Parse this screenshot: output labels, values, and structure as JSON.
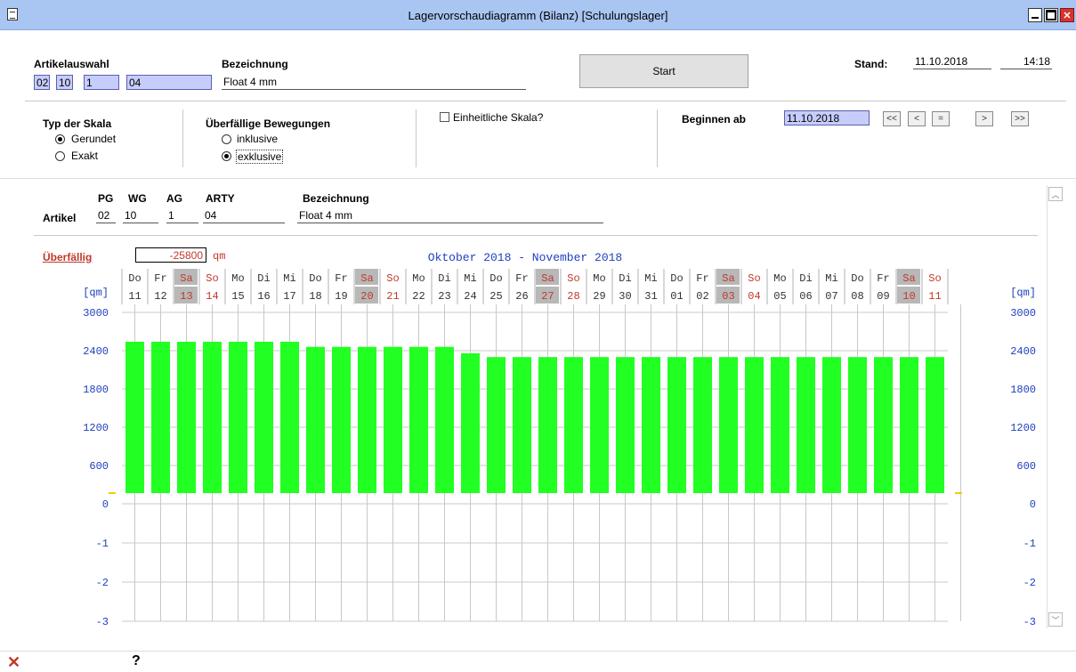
{
  "window": {
    "title": "Lagervorschaudiagramm (Bilanz) [Schulungslager]"
  },
  "artikelauswahl": {
    "label": "Artikelauswahl",
    "pg": "02",
    "wg": "10",
    "ag": "1",
    "arty": "04"
  },
  "bezeichnung": {
    "label": "Bezeichnung",
    "value": "Float 4 mm"
  },
  "start_button": "Start",
  "stand": {
    "label": "Stand:",
    "date": "11.10.2018",
    "time": "14:18"
  },
  "skala": {
    "label": "Typ der Skala",
    "options": [
      "Gerundet",
      "Exakt"
    ],
    "selected": "Gerundet"
  },
  "bewegungen": {
    "label": "Überfällige Bewegungen",
    "options": [
      "inklusive",
      "exklusive"
    ],
    "selected": "exklusive"
  },
  "einheitlich": {
    "label": "Einheitliche Skala?",
    "checked": false
  },
  "beginnen": {
    "label": "Beginnen ab",
    "date": "11.10.2018",
    "nav": [
      "<<",
      "<",
      "=",
      ">",
      ">>"
    ]
  },
  "artikel_row": {
    "label": "Artikel",
    "headers": {
      "pg": "PG",
      "wg": "WG",
      "ag": "AG",
      "arty": "ARTY",
      "bez": "Bezeichnung"
    },
    "pg": "02",
    "wg": "10",
    "ag": "1",
    "arty": "04",
    "bez": "Float 4 mm"
  },
  "ueberfaellig": {
    "label": "Überfällig",
    "value": "-25800",
    "unit": "qm"
  },
  "chart_data": {
    "type": "bar",
    "title": "Oktober 2018   -   November 2018",
    "unit_left": "[qm]",
    "unit_right": "[qm]",
    "weekdays": [
      "Do",
      "Fr",
      "Sa",
      "So",
      "Mo",
      "Di",
      "Mi",
      "Do",
      "Fr",
      "Sa",
      "So",
      "Mo",
      "Di",
      "Mi",
      "Do",
      "Fr",
      "Sa",
      "So",
      "Mo",
      "Di",
      "Mi",
      "Do",
      "Fr",
      "Sa",
      "So",
      "Mo",
      "Di",
      "Mi",
      "Do",
      "Fr",
      "Sa",
      "So"
    ],
    "categories": [
      "11",
      "12",
      "13",
      "14",
      "15",
      "16",
      "17",
      "18",
      "19",
      "20",
      "21",
      "22",
      "23",
      "24",
      "25",
      "26",
      "27",
      "28",
      "29",
      "30",
      "31",
      "01",
      "02",
      "03",
      "04",
      "05",
      "06",
      "07",
      "08",
      "09",
      "10",
      "11"
    ],
    "values": [
      2540,
      2540,
      2540,
      2540,
      2540,
      2540,
      2540,
      2460,
      2460,
      2460,
      2460,
      2460,
      2460,
      2360,
      2300,
      2300,
      2300,
      2300,
      2300,
      2300,
      2300,
      2300,
      2300,
      2300,
      2300,
      2300,
      2300,
      2300,
      2300,
      2300,
      2300,
      2300
    ],
    "y_ticks_upper": [
      "3000",
      "2400",
      "1800",
      "1200",
      "600",
      "0"
    ],
    "y_ticks_lower": [
      "-1",
      "-2",
      "-3"
    ],
    "ylim": [
      0,
      3000
    ],
    "bar_color": "#22ff22",
    "weekend_label_color": "#c0392b",
    "weekday_label_color": "#333333",
    "axis_label_color": "#1e3fbf",
    "saturday_bg": "#b8b8b8",
    "grid": true
  }
}
